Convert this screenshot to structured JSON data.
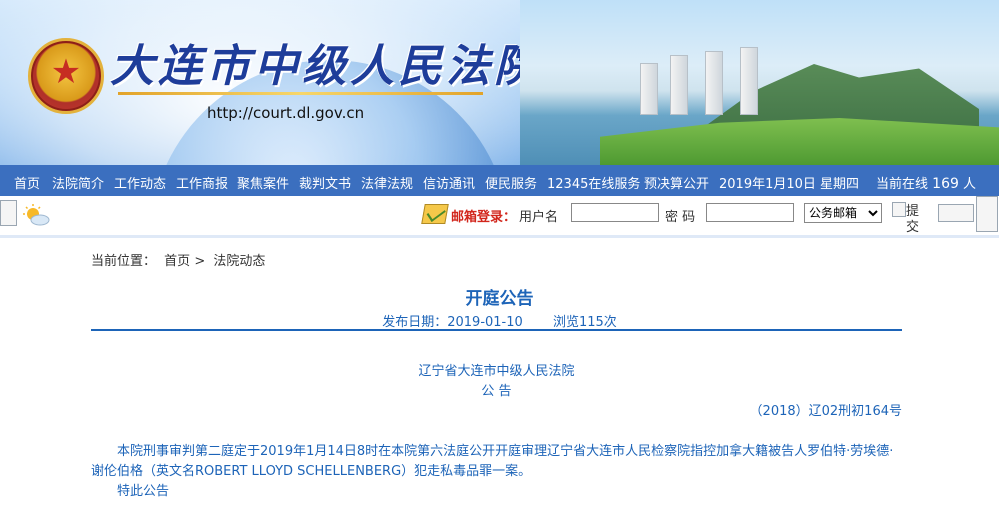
{
  "header": {
    "court_name": "大连市中级人民法院",
    "url": "http://court.dl.gov.cn"
  },
  "nav": {
    "items": [
      {
        "label": "首页"
      },
      {
        "label": "法院简介"
      },
      {
        "label": "工作动态"
      },
      {
        "label": "工作商报"
      },
      {
        "label": "聚焦案件"
      },
      {
        "label": "裁判文书"
      },
      {
        "label": "法律法规"
      },
      {
        "label": "信访通讯"
      },
      {
        "label": "便民服务"
      },
      {
        "label": "12345在线服务"
      },
      {
        "label": "预决算公开"
      }
    ],
    "date": "2019年1月10日 星期四",
    "online_label": "当前在线",
    "online_count": "169",
    "online_unit": "人"
  },
  "toolbar": {
    "mail_login_label": "邮箱登录：",
    "username_label": "用户名",
    "password_label": "密 码",
    "username_value": "",
    "password_value": "",
    "mailbox_select": "公务邮箱",
    "submit_label": "提交"
  },
  "breadcrumb": {
    "prefix": "当前位置：",
    "home": "首页",
    "separator": ">",
    "section": "法院动态"
  },
  "article": {
    "title": "开庭公告",
    "publish_label": "发布日期：2019-01-10",
    "views_label": "浏览115次",
    "org": "辽宁省大连市中级人民法院",
    "notice": "公 告",
    "case_no": "（2018）辽02刑初164号",
    "body": "本院刑事审判第二庭定于2019年1月14日8时在本院第六法庭公开开庭审理辽宁省大连市人民检察院指控加拿大籍被告人罗伯特·劳埃德·谢伦伯格（英文名ROBERT LLOYD SCHELLENBERG）犯走私毒品罪一案。",
    "closing": "特此公告"
  },
  "colors": {
    "nav_bg": "#3b6fbf",
    "accent_blue": "#1d64b8",
    "mail_red": "#d2261c",
    "title_blue": "#1e3d9a"
  }
}
